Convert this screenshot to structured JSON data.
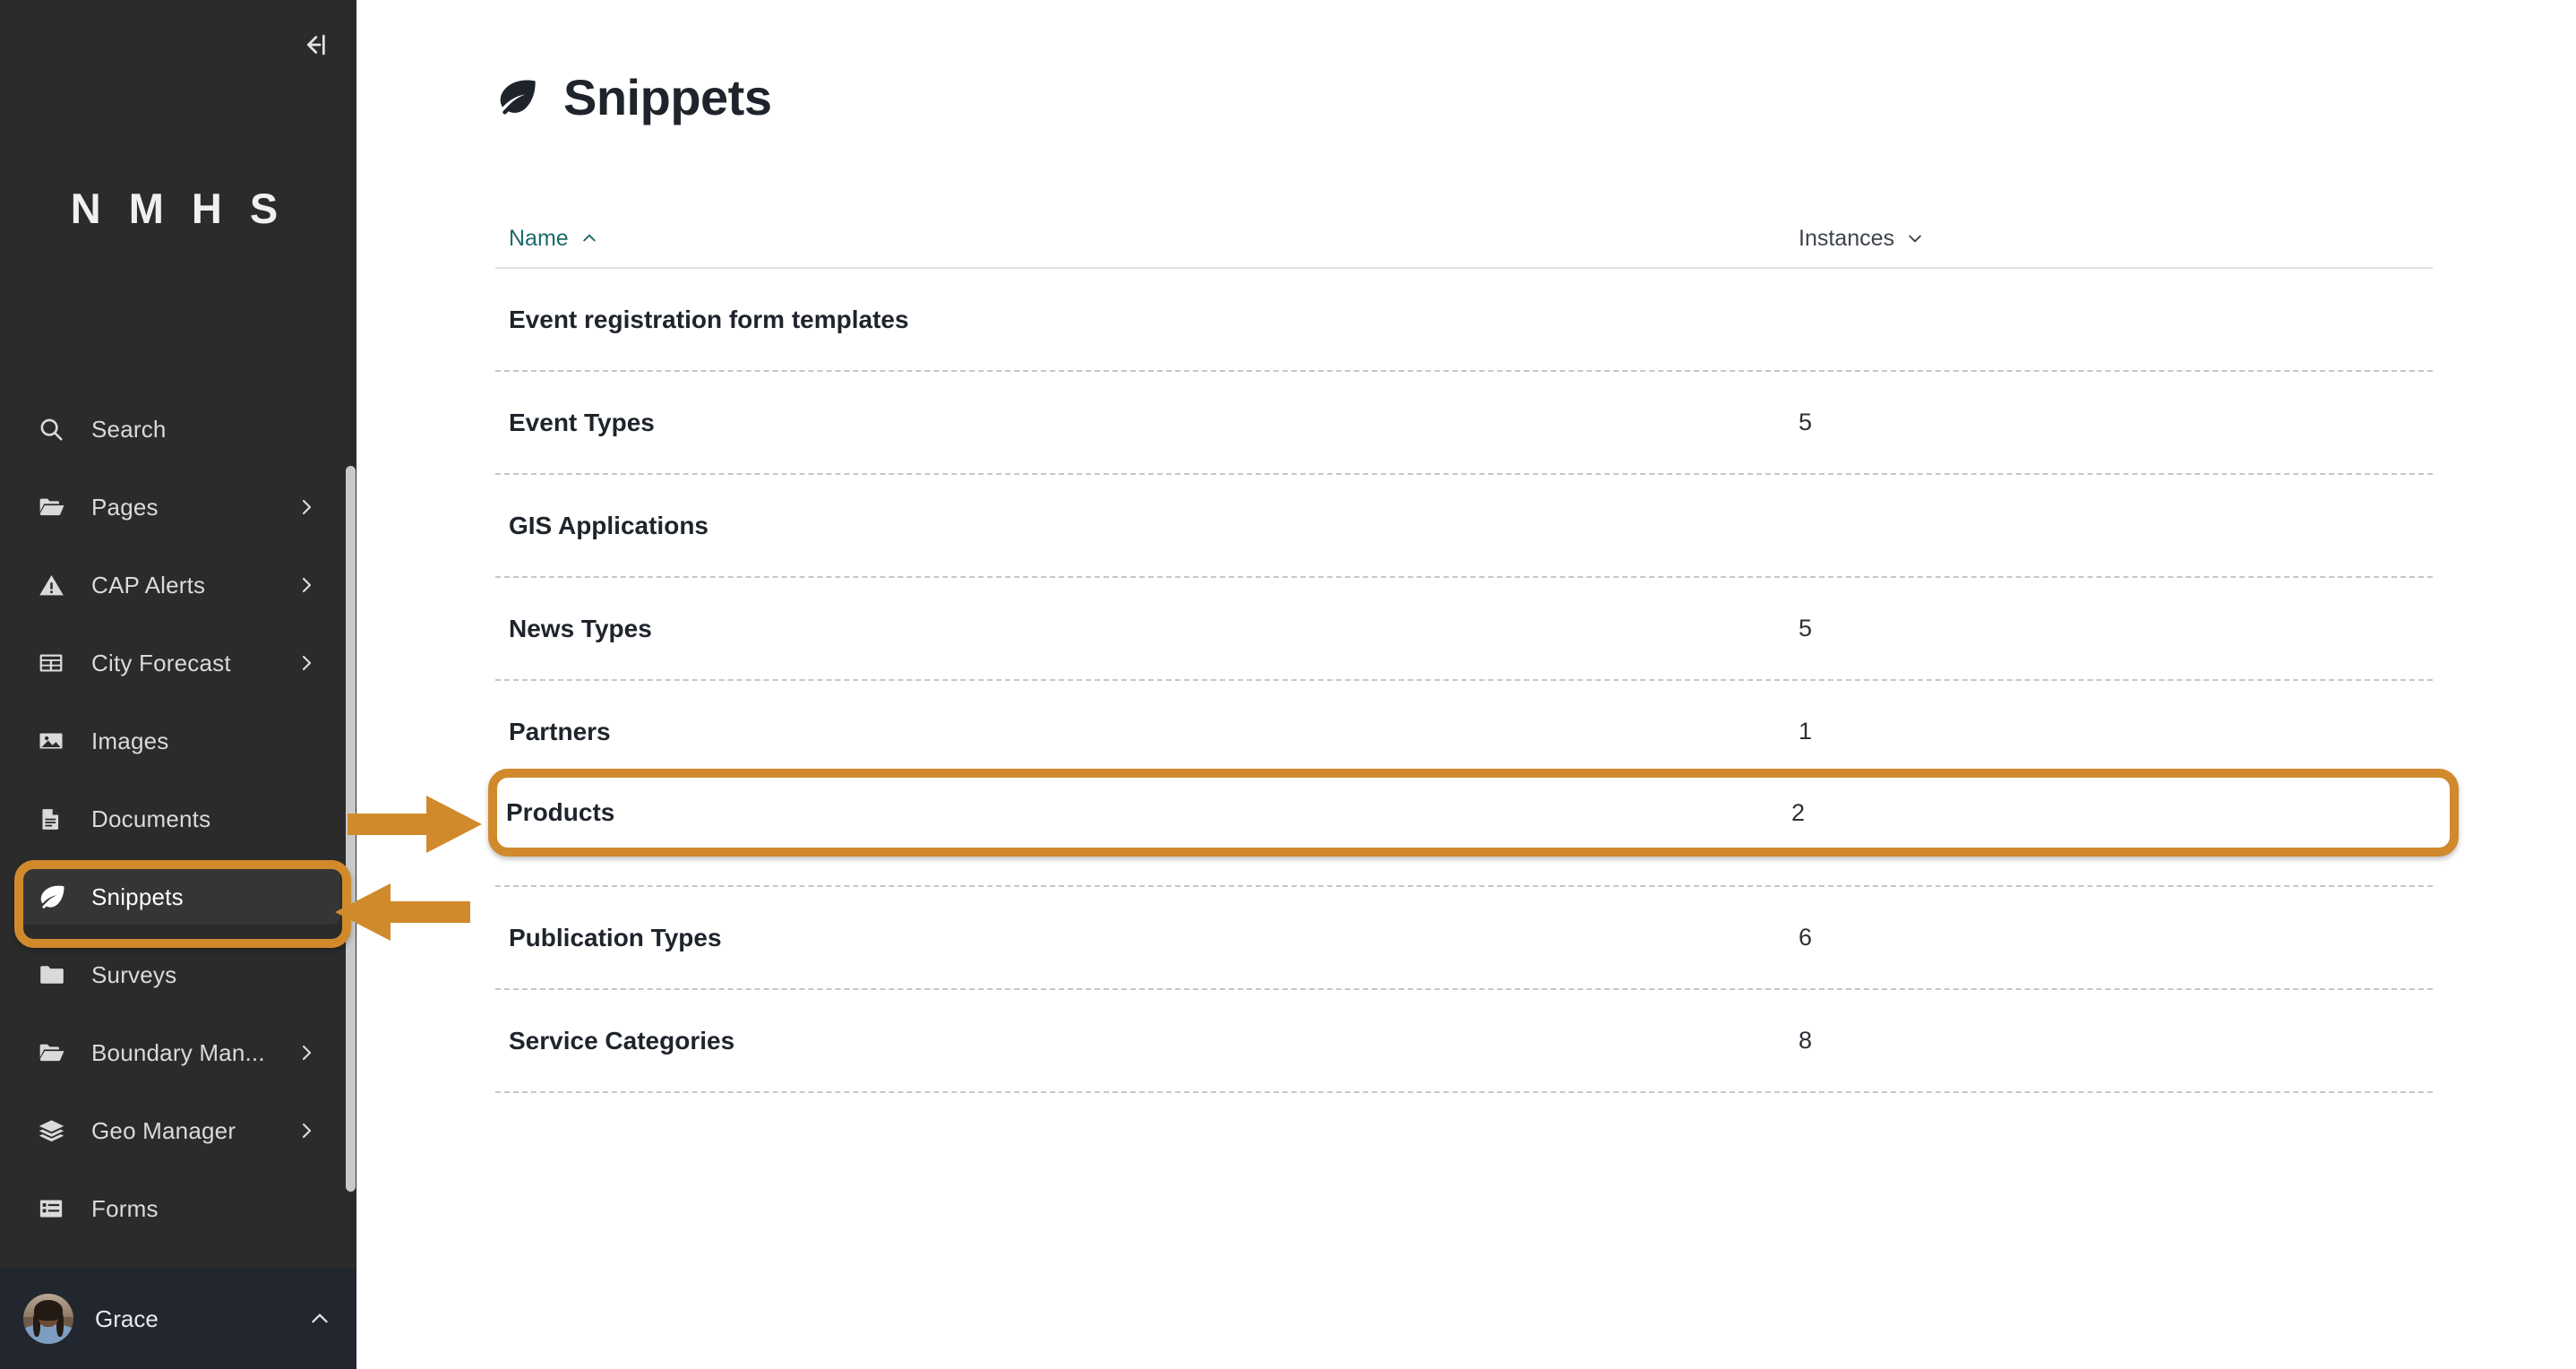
{
  "sidebar": {
    "collapse_icon": "collapse-panel-icon",
    "brand": "N M H S",
    "items": [
      {
        "label": "Search",
        "icon": "search-icon",
        "has_caret": false,
        "active": false
      },
      {
        "label": "Pages",
        "icon": "folder-open-icon",
        "has_caret": true,
        "active": false
      },
      {
        "label": "CAP Alerts",
        "icon": "warning-icon",
        "has_caret": true,
        "active": false
      },
      {
        "label": "City Forecast",
        "icon": "table-icon",
        "has_caret": true,
        "active": false
      },
      {
        "label": "Images",
        "icon": "image-icon",
        "has_caret": false,
        "active": false
      },
      {
        "label": "Documents",
        "icon": "document-icon",
        "has_caret": false,
        "active": false
      },
      {
        "label": "Snippets",
        "icon": "leaf-icon",
        "has_caret": false,
        "active": true
      },
      {
        "label": "Surveys",
        "icon": "folder-icon",
        "has_caret": false,
        "active": false
      },
      {
        "label": "Boundary Man...",
        "icon": "folder-open-icon",
        "has_caret": true,
        "active": false
      },
      {
        "label": "Geo Manager",
        "icon": "layers-icon",
        "has_caret": true,
        "active": false
      },
      {
        "label": "Forms",
        "icon": "list-icon",
        "has_caret": false,
        "active": false
      }
    ],
    "user": {
      "name": "Grace",
      "caret_icon": "chevron-up-icon",
      "avatar": "user-avatar"
    }
  },
  "header": {
    "icon": "leaf-icon",
    "title": "Snippets"
  },
  "table": {
    "columns": [
      {
        "label": "Name",
        "sort": "ascending",
        "sort_icon": "chevron-up-icon",
        "accent": "#1c6b6b"
      },
      {
        "label": "Instances",
        "sort": "descending",
        "sort_icon": "chevron-down-icon",
        "accent": "#3d434c"
      }
    ],
    "rows": [
      {
        "name": "Event registration form templates",
        "instances": ""
      },
      {
        "name": "Event Types",
        "instances": "5"
      },
      {
        "name": "GIS Applications",
        "instances": ""
      },
      {
        "name": "News Types",
        "instances": "5"
      },
      {
        "name": "Partners",
        "instances": "1"
      },
      {
        "name": "Products",
        "instances": "2"
      },
      {
        "name": "Publication Types",
        "instances": "6"
      },
      {
        "name": "Service Categories",
        "instances": "8"
      }
    ]
  },
  "annotations": {
    "accent_color": "#d08a2c",
    "highlighted_row": "Products",
    "highlighted_nav_item": "Snippets",
    "arrows": [
      {
        "name": "arrow-to-products-row",
        "direction": "right"
      },
      {
        "name": "arrow-to-snippets-nav",
        "direction": "left"
      }
    ]
  }
}
